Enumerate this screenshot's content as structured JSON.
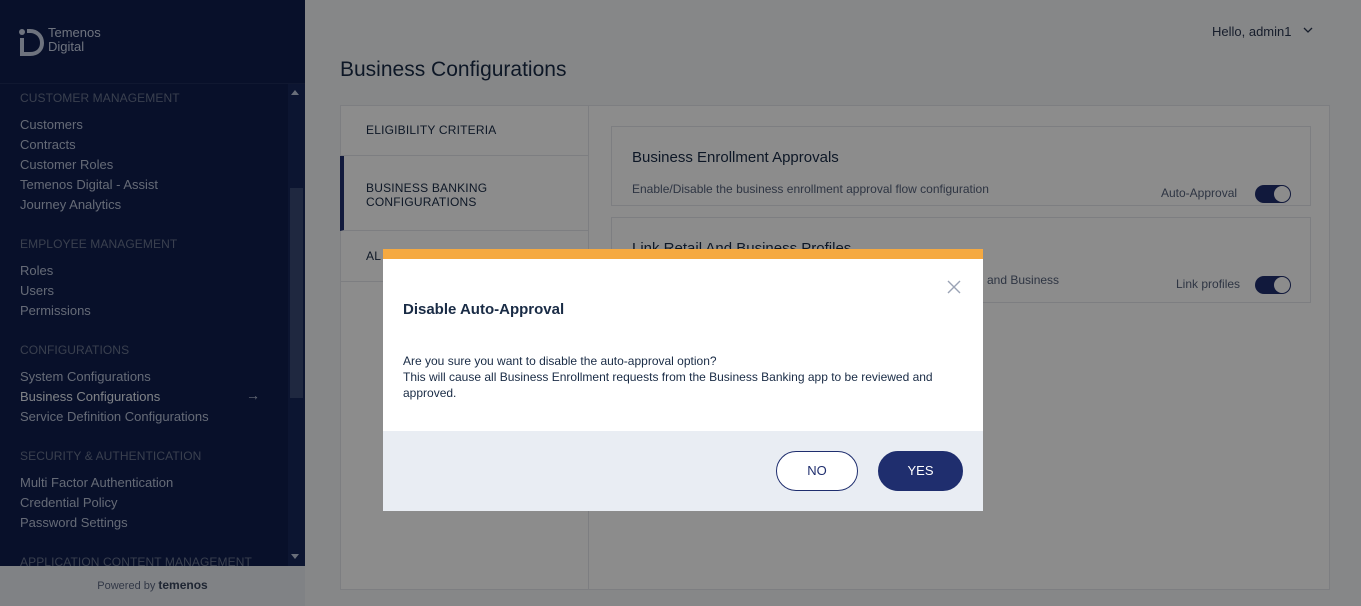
{
  "app": {
    "logo_line1": "Temenos",
    "logo_line2": "Digital",
    "powered_by": "Powered by",
    "powered_brand": "temenos"
  },
  "sidebar": {
    "sections": [
      {
        "title": "CUSTOMER MANAGEMENT",
        "items": [
          "Customers",
          "Contracts",
          "Customer Roles",
          "Temenos Digital - Assist",
          "Journey Analytics"
        ]
      },
      {
        "title": "EMPLOYEE MANAGEMENT",
        "items": [
          "Roles",
          "Users",
          "Permissions"
        ]
      },
      {
        "title": "CONFIGURATIONS",
        "items": [
          "System Configurations",
          "Business Configurations",
          "Service Definition Configurations"
        ]
      },
      {
        "title": "SECURITY & AUTHENTICATION",
        "items": [
          "Multi Factor Authentication",
          "Credential Policy",
          "Password Settings"
        ]
      },
      {
        "title": "APPLICATION CONTENT MANAGEMENT",
        "items": []
      }
    ],
    "active_item": "Business Configurations"
  },
  "header": {
    "user_greeting": "Hello, admin1"
  },
  "page": {
    "title": "Business Configurations",
    "tabs": [
      {
        "label": "ELIGIBILITY CRITERIA"
      },
      {
        "label_line1": "BUSINESS BANKING",
        "label_line2": "CONFIGURATIONS"
      },
      {
        "label": "AL"
      }
    ],
    "panels": [
      {
        "title": "Business Enrollment Approvals",
        "description": "Enable/Disable the business enrollment approval flow configuration",
        "toggle_label": "Auto-Approval",
        "toggle_on": true
      },
      {
        "title": "Link Retail And Business Profiles",
        "description": "and Business",
        "toggle_label": "Link profiles",
        "toggle_on": true
      }
    ]
  },
  "modal": {
    "title": "Disable Auto-Approval",
    "line1": "Are you sure you want to disable the auto-approval option?",
    "line2": "This will cause all Business Enrollment requests from the Business Banking app to be reviewed and approved.",
    "no_label": "NO",
    "yes_label": "YES"
  },
  "colors": {
    "sidebar_bg": "#0f1e4d",
    "accent": "#1f2e6e",
    "modal_bar": "#f5a941"
  }
}
